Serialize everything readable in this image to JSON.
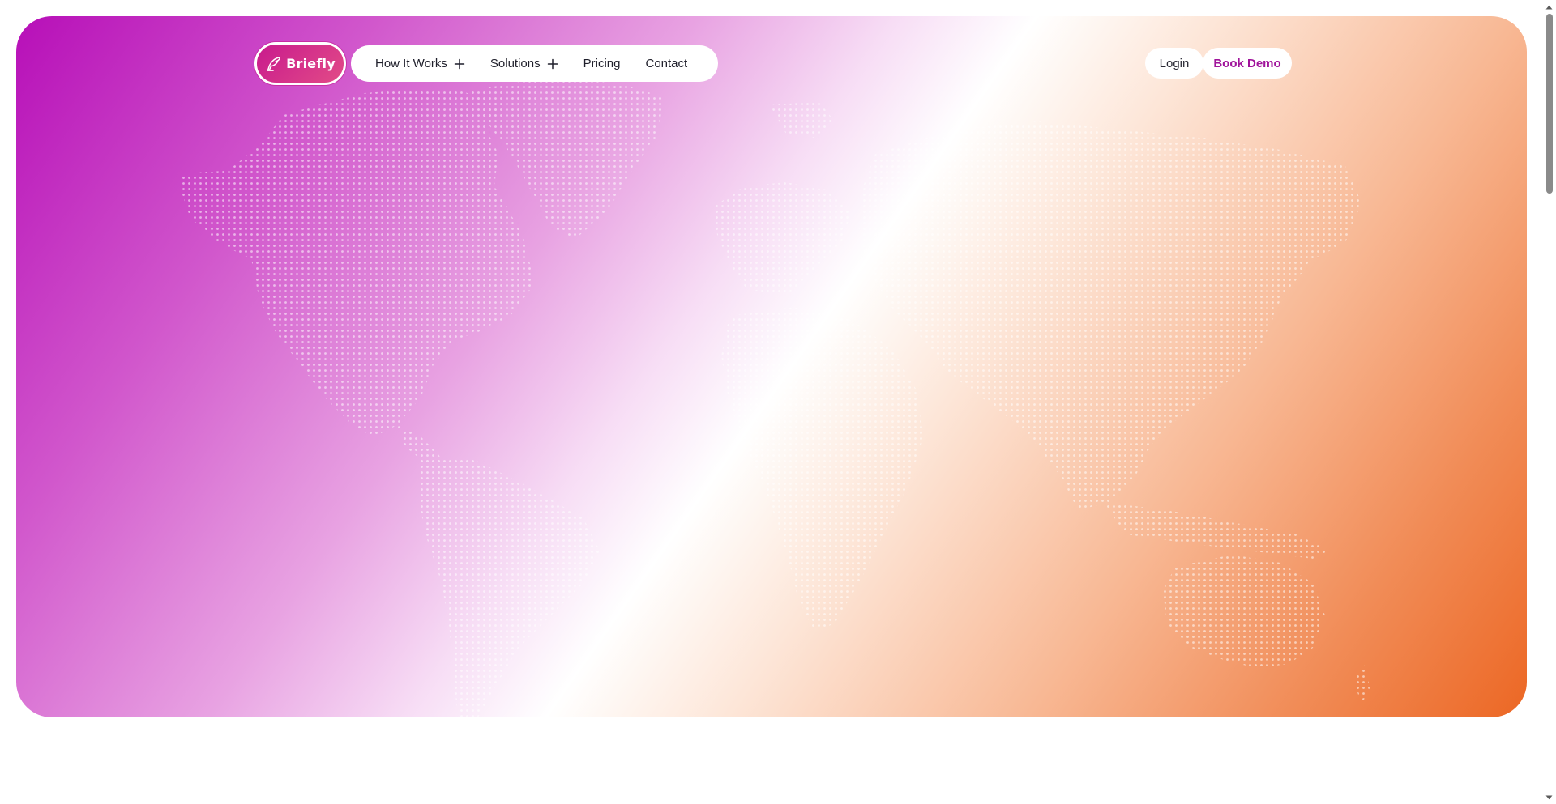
{
  "brand": {
    "name": "Briefly",
    "icon": "quill-icon"
  },
  "nav": {
    "items": [
      {
        "label": "How It Works",
        "has_submenu": true,
        "icon": "plus-icon"
      },
      {
        "label": "Solutions",
        "has_submenu": true,
        "icon": "plus-icon"
      },
      {
        "label": "Pricing",
        "has_submenu": false
      },
      {
        "label": "Contact",
        "has_submenu": false
      }
    ],
    "login_label": "Login",
    "demo_label": "Book Demo"
  },
  "hero": {
    "background": "world-map-dots",
    "gradient_colors": [
      "#b70fb8",
      "#ffffff",
      "#ec6724"
    ]
  },
  "colors": {
    "accent": "#a0149b",
    "logo_bg": "#c81a8d",
    "orange": "#ec6724"
  }
}
